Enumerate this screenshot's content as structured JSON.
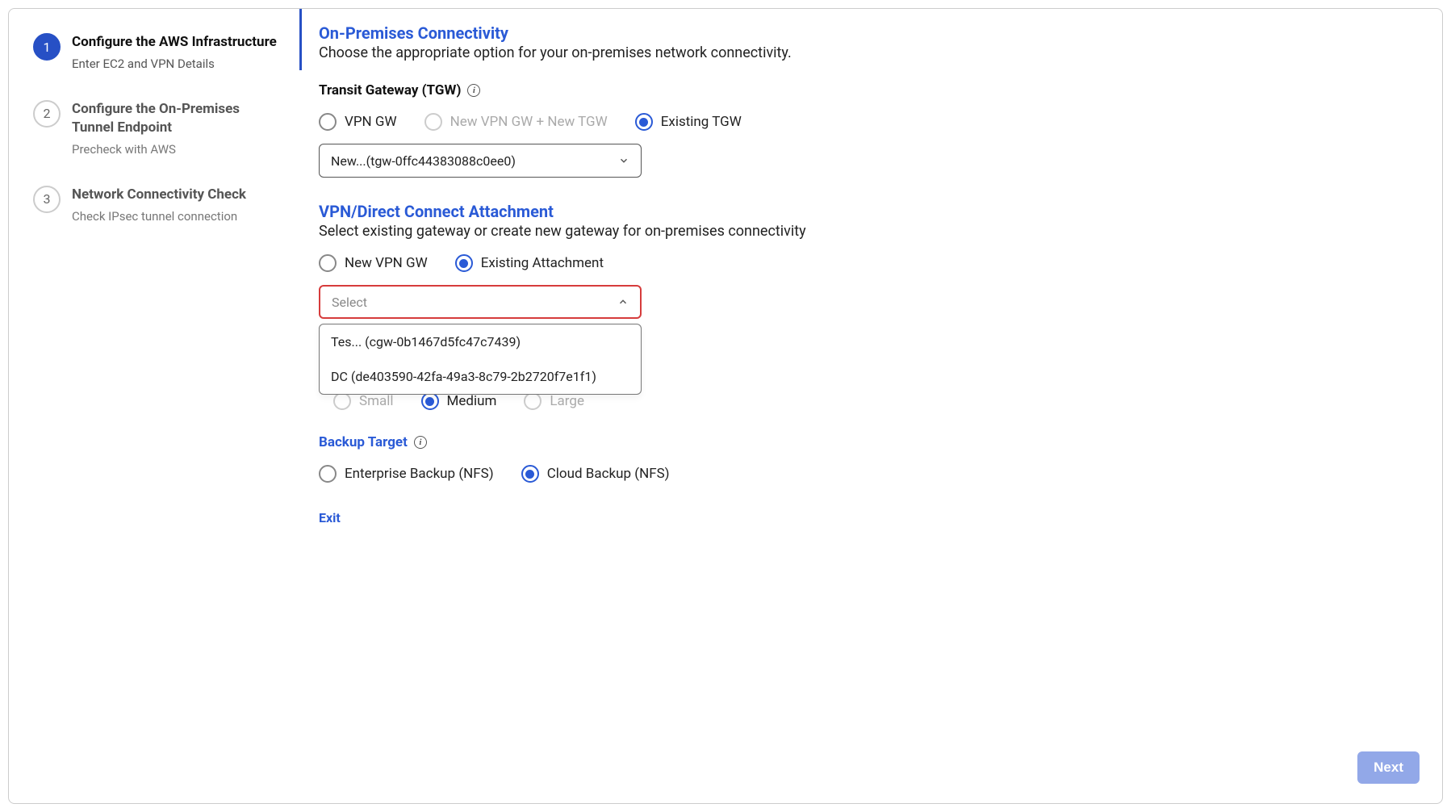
{
  "sidebar": {
    "steps": [
      {
        "num": "1",
        "title": "Configure the AWS Infrastructure",
        "sub": "Enter EC2 and VPN Details"
      },
      {
        "num": "2",
        "title": "Configure the On-Premises Tunnel Endpoint",
        "sub": "Precheck with AWS"
      },
      {
        "num": "3",
        "title": "Network Connectivity Check",
        "sub": "Check IPsec tunnel connection"
      }
    ]
  },
  "sections": {
    "onprem": {
      "title": "On-Premises Connectivity",
      "desc": "Choose the appropriate option for your on-premises network connectivity."
    },
    "tgw": {
      "label": "Transit Gateway (TGW)",
      "options": {
        "vpn_gw": "VPN GW",
        "new_vpn_tgw": "New VPN GW + New TGW",
        "existing_tgw": "Existing TGW"
      },
      "select_value": "New...(tgw-0ffc44383088c0ee0)"
    },
    "attach": {
      "title": "VPN/Direct Connect Attachment",
      "desc": "Select existing gateway or create new gateway for on-premises connectivity",
      "options": {
        "new_vpn_gw": "New VPN GW",
        "existing_attach": "Existing Attachment"
      },
      "select_placeholder": "Select",
      "dropdown": [
        "Tes... (cgw-0b1467d5fc47c7439)",
        "DC (de403590-42fa-49a3-8c79-2b2720f7e1f1)"
      ]
    },
    "size": {
      "small": "Small",
      "medium": "Medium",
      "large": "Large"
    },
    "backup": {
      "title": "Backup Target",
      "options": {
        "enterprise": "Enterprise Backup (NFS)",
        "cloud": "Cloud Backup (NFS)"
      }
    }
  },
  "footer": {
    "exit": "Exit",
    "next": "Next"
  }
}
